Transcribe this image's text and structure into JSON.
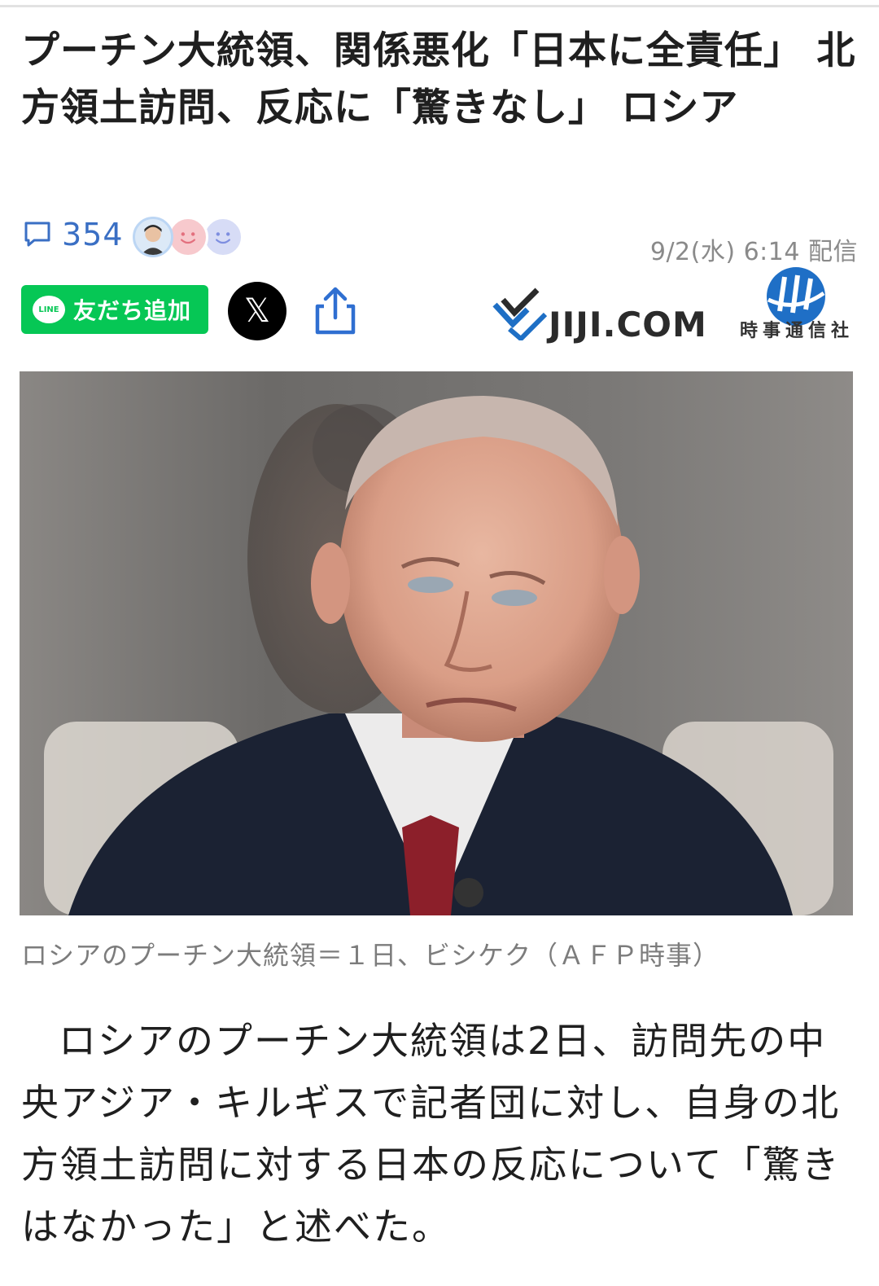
{
  "article": {
    "title": "プーチン大統領、関係悪化「日本に全責任」 北方領土訪問、反応に「驚きなし」 ロシア",
    "comment_count": "354",
    "published": "9/2(水) 6:14 配信",
    "photo_caption": "ロシアのプーチン大統領＝１日、ビシケク（ＡＦＰ時事）",
    "body": "ロシアのプーチン大統領は2日、訪問先の中央アジア・キルギスで記者団に対し、自身の北方領土訪問に対する日本の反応について「驚きはなかった」と述べた。"
  },
  "share": {
    "line_label": "友だち追加",
    "line_logo": "LINE",
    "x_label": "𝕏"
  },
  "source": {
    "jiji_com": "JIJI.COM",
    "jiji_press": "時事通信社"
  },
  "icons": {
    "comment": "speech-bubble-icon",
    "share": "share-icon"
  },
  "colors": {
    "line_green": "#06c755",
    "comment_blue": "#3a6fc4",
    "jiji_blue": "#1f6fc6"
  }
}
